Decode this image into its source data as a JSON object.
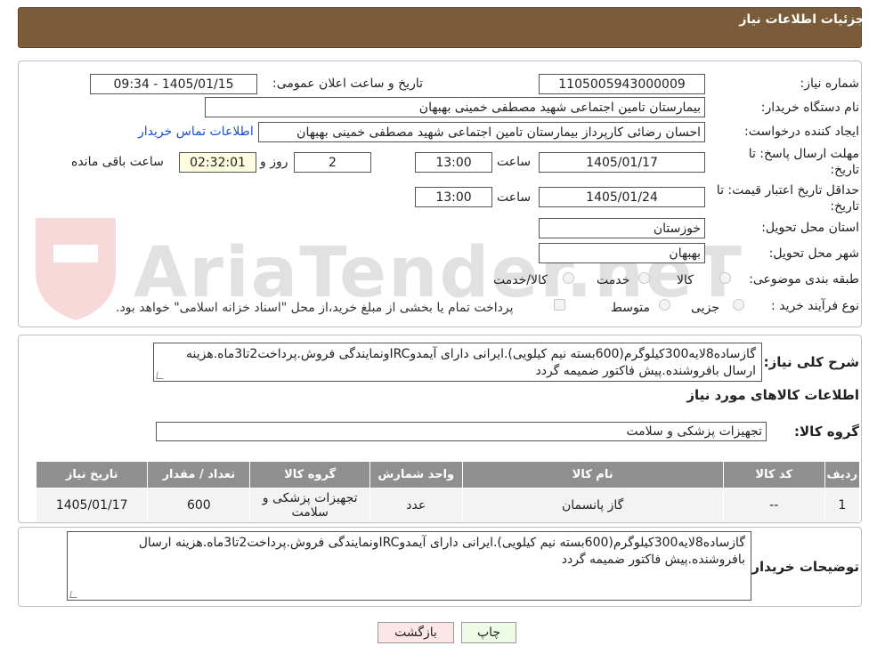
{
  "header": {
    "title": "جزئیات اطلاعات نیاز"
  },
  "watermark": {
    "text": "AriaTender.neT"
  },
  "info": {
    "need_number_label": "شماره نیاز:",
    "need_number": "1105005943000009",
    "announce_label": "تاریخ و ساعت اعلان عمومی:",
    "announce_value": "1405/01/15 - 09:34",
    "buyer_org_label": "نام دستگاه خریدار:",
    "buyer_org": "بیمارستان تامین اجتماعی شهید مصطفی خمینی بهبهان",
    "creator_label": "ایجاد کننده درخواست:",
    "creator": "احسان رضائی کارپرداز بیمارستان تامین اجتماعی شهید مصطفی خمینی بهبهان",
    "contact_link": "اطلاعات تماس خریدار",
    "deadline_label_1": "مهلت ارسال پاسخ: تا",
    "deadline_label_2": "تاریخ:",
    "deadline_date": "1405/01/17",
    "time_label": "ساعت",
    "deadline_time": "13:00",
    "days_value": "2",
    "days_label": "روز و",
    "remaining_time": "02:32:01",
    "remaining_label": "ساعت باقی مانده",
    "validity_label_1": "حداقل تاریخ اعتبار قیمت: تا",
    "validity_label_2": "تاریخ:",
    "validity_date": "1405/01/24",
    "validity_time": "13:00",
    "province_label": "استان محل تحویل:",
    "province": "خوزستان",
    "city_label": "شهر محل تحویل:",
    "city": "بهبهان",
    "category_label": "طبقه بندی موضوعی:",
    "category_options": [
      "کالا",
      "خدمت",
      "کالا/خدمت"
    ],
    "process_label": "نوع فرآیند خرید :",
    "process_options": [
      "جزیی",
      "متوسط"
    ],
    "payment_note": "پرداخت تمام یا بخشی از مبلغ خرید،از محل \"اسناد خزانه اسلامی\" خواهد بود."
  },
  "description": {
    "label": "شرح کلی نیاز:",
    "text": "گازساده8لایه300کیلوگرم(600بسته نیم کیلویی).ایرانی دارای آیمدوIRCونمایندگی فروش.پرداخت2تا3ماه.هزینه ارسال بافروشنده.پیش فاکتور ضمیمه گردد"
  },
  "goods": {
    "section_title": "اطلاعات کالاهای مورد نیاز",
    "group_label": "گروه کالا:",
    "group_value": "تجهیزات پزشکی و سلامت",
    "columns": [
      "ردیف",
      "کد کالا",
      "نام کالا",
      "واحد شمارش",
      "گروه کالا",
      "تعداد / مقدار",
      "تاریخ نیاز"
    ],
    "rows": [
      [
        "1",
        "--",
        "گاز پانسمان",
        "عدد",
        "تجهیزات پزشکی و سلامت",
        "600",
        "1405/01/17"
      ]
    ]
  },
  "buyer_notes": {
    "label": "توضیحات خریدار:",
    "text": "گازساده8لایه300کیلوگرم(600بسته نیم کیلویی).ایرانی دارای آیمدوIRCونمایندگی فروش.پرداخت2تا3ماه.هزینه ارسال بافروشنده.پیش فاکتور ضمیمه گردد"
  },
  "buttons": {
    "print": "چاپ",
    "back": "بازگشت"
  },
  "colors": {
    "header": "#7a5c3a",
    "print_bg": "#eefce6",
    "back_bg": "#fde6e6"
  }
}
